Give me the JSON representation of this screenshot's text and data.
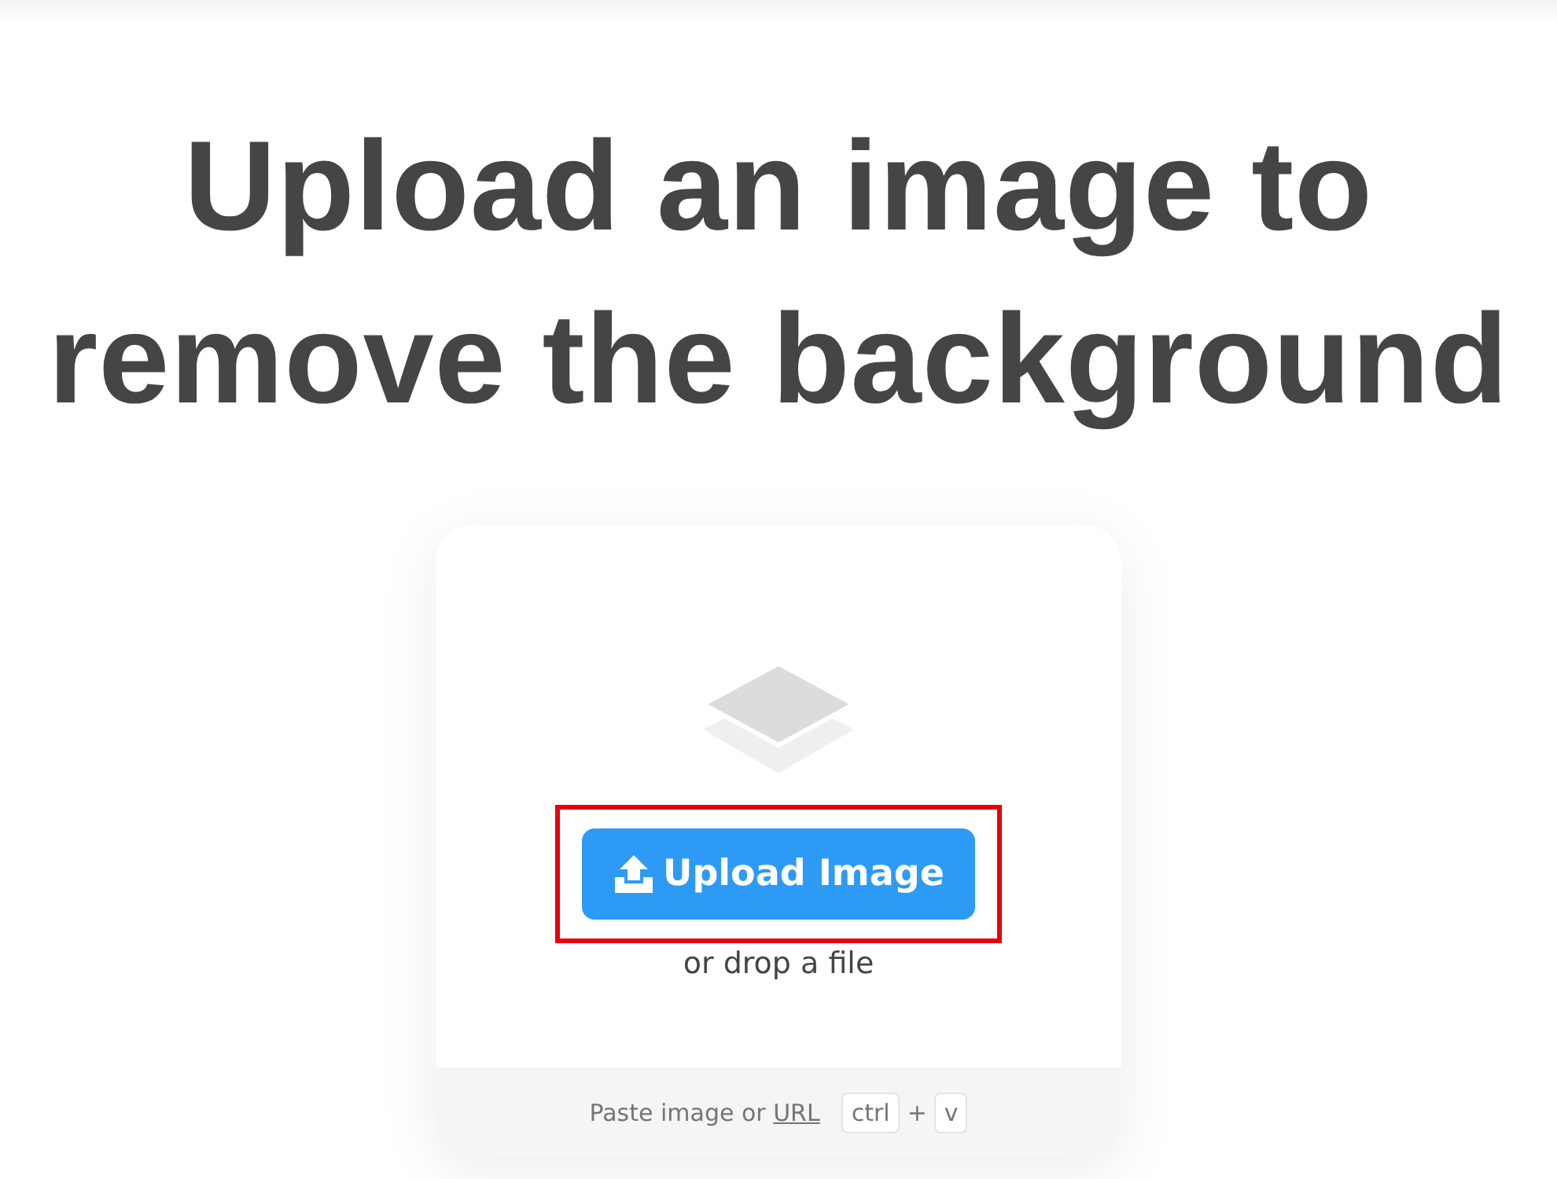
{
  "heading": {
    "lines": [
      "Upload an image to",
      "remove the background"
    ]
  },
  "upload_card": {
    "button": {
      "label": "Upload Image",
      "highlighted": true
    },
    "drop_hint": "or drop a file",
    "paste_bar": {
      "text": "Paste image or ",
      "link": "URL",
      "keys": [
        "ctrl",
        "v"
      ],
      "joiner": "+"
    }
  }
}
